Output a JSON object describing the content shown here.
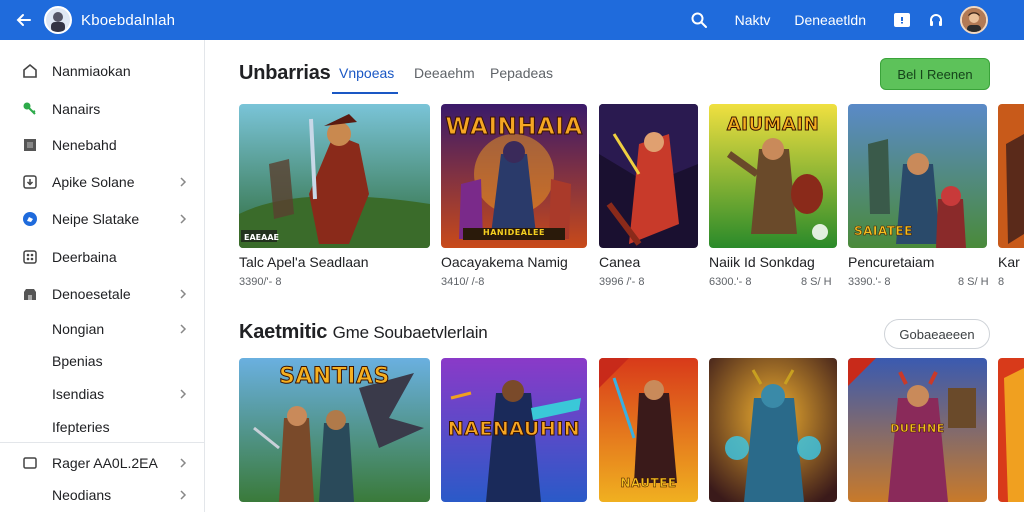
{
  "topbar": {
    "app_title": "Kboebdalnlah",
    "links": [
      "Naktv",
      "Deneaetldn"
    ]
  },
  "sidebar": {
    "items": [
      {
        "label": "Nanmiaokan",
        "icon": "home-icon",
        "chevron": false
      },
      {
        "label": "Nanairs",
        "icon": "key-icon",
        "chevron": false
      },
      {
        "label": "Nenebahd",
        "icon": "grid-square-icon",
        "chevron": false
      },
      {
        "label": "Apike Solane",
        "icon": "download-icon",
        "chevron": true
      },
      {
        "label": "Neipe Slatake",
        "icon": "shield-icon",
        "chevron": true
      },
      {
        "label": "Deerbaina",
        "icon": "apps-icon",
        "chevron": false
      },
      {
        "label": "Denoesetale",
        "icon": "store-icon",
        "chevron": true
      },
      {
        "label": "Nongian",
        "icon": "",
        "chevron": true
      },
      {
        "label": "Bpenias",
        "icon": "",
        "chevron": false
      },
      {
        "label": "Isendias",
        "icon": "",
        "chevron": true
      },
      {
        "label": "Ifepteries",
        "icon": "",
        "chevron": false
      },
      {
        "label": "Rager AA0L.2EA",
        "icon": "wallet-icon",
        "chevron": true
      },
      {
        "label": "Neodians",
        "icon": "",
        "chevron": true
      }
    ]
  },
  "section1": {
    "title": "Unbarrias",
    "tabs": [
      "Vnpoeas",
      "Deeaehm",
      "Pepadeas"
    ],
    "cta_label": "Bel I Reenen",
    "cards": [
      {
        "title": "Talc  Apel'a Seadlaan",
        "meta": "3390/'- 8",
        "meta2": "",
        "banner": "",
        "badge": "EAEAAE"
      },
      {
        "title": "Oacayakema Namig",
        "meta": "3410/ /-8",
        "meta2": "",
        "banner": "WAINHAIA",
        "badge": "HANIDEALEE"
      },
      {
        "title": "Canea",
        "meta": "3996 /'- 8",
        "meta2": "",
        "banner": "",
        "badge": ""
      },
      {
        "title": "Naiik  Id Sonkdag",
        "meta": "6300.'- 8",
        "meta2": "8 S/ H",
        "banner": "AIUMAIN",
        "badge": ""
      },
      {
        "title": "Pencuretaiam",
        "meta": "3390.'- 8",
        "meta2": "8 S/ H",
        "banner": "",
        "badge": "SAIATEE"
      },
      {
        "title": "Kar",
        "meta": "8",
        "meta2": "",
        "banner": "",
        "badge": ""
      }
    ]
  },
  "section2": {
    "title": "Kaetmitic",
    "subtitle": "Gme  Soubaetvlerlain",
    "button_label": "Gobaeaeeen",
    "cards": [
      {
        "banner": "SANTIAS",
        "badge": ""
      },
      {
        "banner": "NAENAUHIN",
        "badge": ""
      },
      {
        "banner": "",
        "badge": "NAUTEE"
      },
      {
        "banner": "",
        "badge": ""
      },
      {
        "banner": "",
        "badge": "DUEHNE"
      },
      {
        "banner": "",
        "badge": ""
      }
    ]
  },
  "colors": {
    "topbar": "#1f6bdc",
    "accent": "#1a57c4",
    "cta": "#5dc25a"
  }
}
